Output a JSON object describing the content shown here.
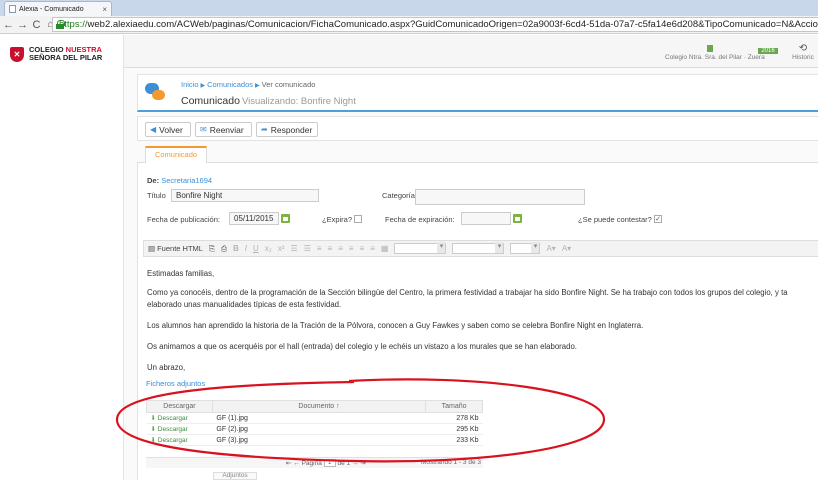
{
  "browser": {
    "tab_title": "Alexia - Comunicado",
    "tab_close": "×",
    "nav_back": "←",
    "nav_forward": "→",
    "nav_reload": "C",
    "nav_home": "⌂",
    "url_scheme": "https://",
    "url_rest": "web2.alexiaedu.com/ACWeb/paginas/Comunicacion/FichaComunicado.aspx?GuidComunicadoOrigen=02a9003f-6cd4-51da-07a7-c5fa14e6d208&TipoComunicado=N&AccionC"
  },
  "logo": {
    "line1_a": "COLEGIO ",
    "line1_b": "NUESTRA",
    "line2": "SEÑORA DEL PILAR"
  },
  "topbar": {
    "school_label": "Colegio Ntra. Sra. del Pilar · Zuera",
    "year_badge": "2016",
    "history_label": "Historic"
  },
  "header": {
    "breadcrumb": [
      "Inicio",
      "Comunicados",
      "Ver comunicado"
    ],
    "title": "Comunicado",
    "subtitle": "Visualizando: Bonfire Night"
  },
  "toolbar": {
    "back_label": "Volver",
    "forward_label": "Reenviar",
    "reply_label": "Responder"
  },
  "tabs": {
    "main": "Comunicado"
  },
  "form": {
    "from_label": "De:",
    "from_value": "Secretaria1694",
    "title_label": "Título",
    "title_value": "Bonfire Night",
    "category_label": "Categoría",
    "category_value": "",
    "pub_date_label": "Fecha de publicación:",
    "pub_date_value": "05/11/2015",
    "expires_label": "¿Expira?",
    "exp_date_label": "Fecha de expiración:",
    "exp_date_value": "",
    "can_reply_label": "¿Se puede contestar?"
  },
  "editor": {
    "source_label": "Fuente HTML",
    "bold": "B",
    "italic": "I",
    "underline": "U"
  },
  "message": {
    "p1": "Estimadas familias,",
    "p2a": "Como ya conocéis, dentro de la programación de la Sección bilingüe del Centro, la primera festividad a trabajar ha sido Bonfire Night. Se ha trabajo con todos los grupos del colegio, y ta",
    "p2b": "elaborado unas manualidades típicas de esta festividad.",
    "p3": "Los alumnos han aprendido la historia de la Tración de la Pólvora, conocen a Guy Fawkes y saben como se celebra Bonfire Night en Inglaterra.",
    "p4": "Os animamos a que os acerquéis por el hall (entrada) del colegio y le echéis un vistazo a los murales que se han elaborado.",
    "p5": "Un abrazo,"
  },
  "attachments": {
    "title": "Ficheros adjuntos",
    "headers": [
      "Descargar",
      "Documento",
      "Tamaño"
    ],
    "sort_icon": "↑",
    "download_label": "Descargar",
    "rows": [
      {
        "name": "GF (1).jpg",
        "size": "278 Kb"
      },
      {
        "name": "GF (2).jpg",
        "size": "295 Kb"
      },
      {
        "name": "GF (3).jpg",
        "size": "233 Kb"
      }
    ],
    "pager_page": "Página",
    "pager_page_value": "1",
    "pager_of": "de 1",
    "pager_showing": "Mostrando 1 - 3 de 3"
  },
  "below_button": "Adjuntos",
  "colors": {
    "accent": "#3a8fd6",
    "orange": "#f29a2e",
    "green": "#6aa84f",
    "annotation": "#d9121f"
  }
}
